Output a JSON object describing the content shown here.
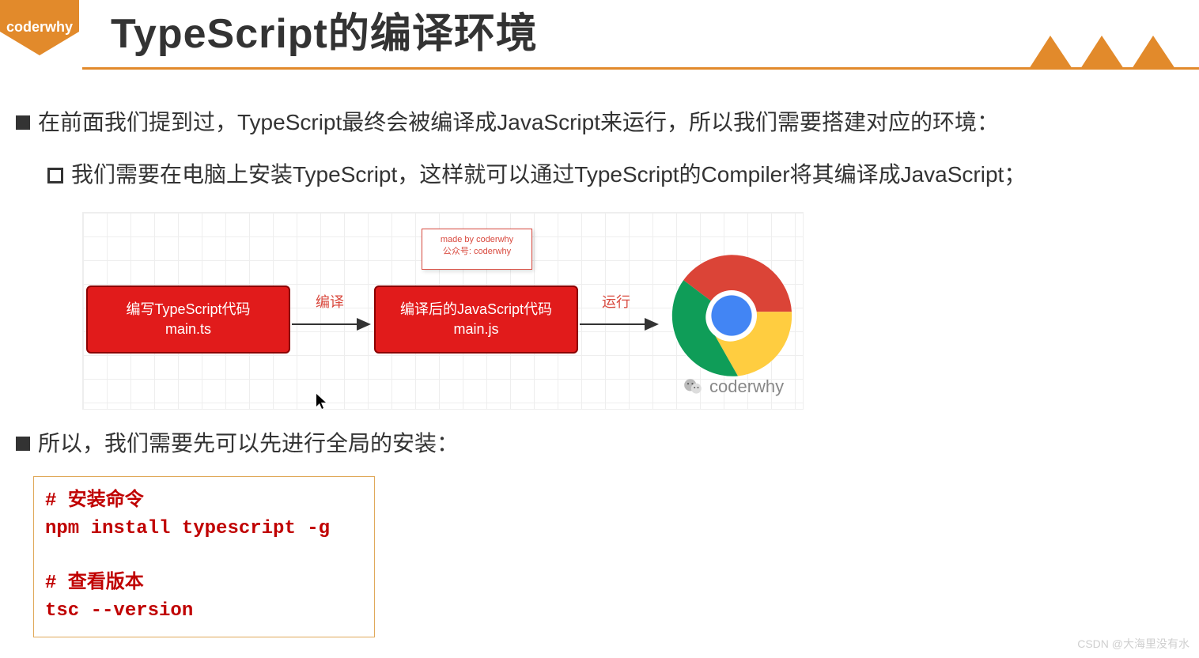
{
  "header": {
    "logo_text": "coderwhy",
    "title": "TypeScript的编译环境"
  },
  "bullets": {
    "b1": "在前面我们提到过，TypeScript最终会被编译成JavaScript来运行，所以我们需要搭建对应的环境：",
    "b1_1": "我们需要在电脑上安装TypeScript，这样就可以通过TypeScript的Compiler将其编译成JavaScript；",
    "b2": "所以，我们需要先可以先进行全局的安装："
  },
  "diagram": {
    "note_line1": "made by coderwhy",
    "note_line2": "公众号: coderwhy",
    "box1_line1": "编写TypeScript代码",
    "box1_line2": "main.ts",
    "box2_line1": "编译后的JavaScript代码",
    "box2_line2": "main.js",
    "arrow1_label": "编译",
    "arrow2_label": "运行",
    "watermark": "coderwhy"
  },
  "code": {
    "text": "# 安装命令\nnpm install typescript -g\n\n# 查看版本\ntsc --version"
  },
  "footer": {
    "watermark": "CSDN @大海里没有水"
  }
}
